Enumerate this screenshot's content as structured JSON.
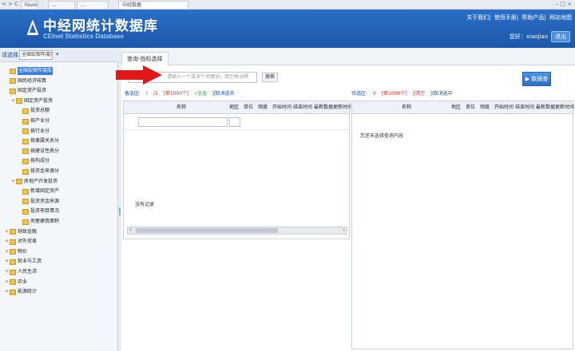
{
  "browser": {
    "nav": "<  >  C",
    "tabs": [
      "Favorites",
      "...",
      "...",
      "中经数据"
    ],
    "window_controls": "– □ ×"
  },
  "header": {
    "title": "中经网统计数据库",
    "subtitle": "CEInet Statistics Database",
    "links": [
      "关于我们",
      "使用手册",
      "帮助产品",
      "网站地图"
    ],
    "user": "您好：xiaojiao",
    "logout": "退出"
  },
  "left": {
    "category_label": "请选择：",
    "category_value": "全国宏观年度库",
    "go": "▾"
  },
  "tree": [
    {
      "label": "全国宏观年度库",
      "level": 0,
      "expand": "",
      "selected": true
    },
    {
      "label": "国民经济核算",
      "level": 0,
      "expand": "",
      "selected": false
    },
    {
      "label": "固定资产投资",
      "level": 0,
      "expand": "",
      "selected": false
    },
    {
      "label": "固定资产投资",
      "level": 1,
      "expand": "+",
      "selected": false
    },
    {
      "label": "投资总额",
      "level": 2,
      "expand": "",
      "selected": false
    },
    {
      "label": "按产业分",
      "level": 2,
      "expand": "",
      "selected": false
    },
    {
      "label": "按行业分",
      "level": 2,
      "expand": "",
      "selected": false
    },
    {
      "label": "按隶属关系分",
      "level": 2,
      "expand": "",
      "selected": false
    },
    {
      "label": "按建设性质分",
      "level": 2,
      "expand": "",
      "selected": false
    },
    {
      "label": "按构成分",
      "level": 2,
      "expand": "",
      "selected": false
    },
    {
      "label": "按资金来源分",
      "level": 2,
      "expand": "",
      "selected": false
    },
    {
      "label": "房地产开发投资",
      "level": 1,
      "expand": "+",
      "selected": false
    },
    {
      "label": "新增固定资产",
      "level": 2,
      "expand": "",
      "selected": false
    },
    {
      "label": "投资资金来源",
      "level": 2,
      "expand": "",
      "selected": false
    },
    {
      "label": "投资项目情况",
      "level": 2,
      "expand": "",
      "selected": false
    },
    {
      "label": "房屋建筑面积",
      "level": 2,
      "expand": "",
      "selected": false
    },
    {
      "label": "财政金融",
      "level": 0,
      "expand": "+",
      "selected": false
    },
    {
      "label": "对外贸易",
      "level": 0,
      "expand": "+",
      "selected": false
    },
    {
      "label": "物价",
      "level": 0,
      "expand": "+",
      "selected": false
    },
    {
      "label": "就业与工资",
      "level": 0,
      "expand": "+",
      "selected": false
    },
    {
      "label": "人民生活",
      "level": 0,
      "expand": "+",
      "selected": false
    },
    {
      "label": "农业",
      "level": 0,
      "expand": "+",
      "selected": false
    },
    {
      "label": "能源统计",
      "level": 0,
      "expand": "+",
      "selected": false
    }
  ],
  "main": {
    "tab": "查询-指标选择",
    "search_placeholder": "请输入一个或多个关键词，用空格分隔",
    "search_button": "搜索",
    "query_button": "数据查询",
    "left_options": {
      "label": "备选区:",
      "a": "I",
      "b": "/3",
      "c": "[第1000个]",
      "add": "√全选",
      "cancel": "╳取消选中"
    },
    "right_options": {
      "label": "待选区:",
      "a": "0",
      "b": "[第1000个]",
      "remove": "╳清空",
      "cancel": "╳取消选中"
    },
    "columns": [
      "名称",
      "地区",
      "单位",
      "频度",
      "开始时间",
      "结束时间",
      "最新数据更新时间"
    ],
    "left_empty": "没有记录",
    "right_empty": "您还未选择查询内容"
  },
  "colors": {
    "header_blue": "#1d57a8",
    "accent": "#2a6fc9",
    "arrow_red": "#e01818"
  }
}
